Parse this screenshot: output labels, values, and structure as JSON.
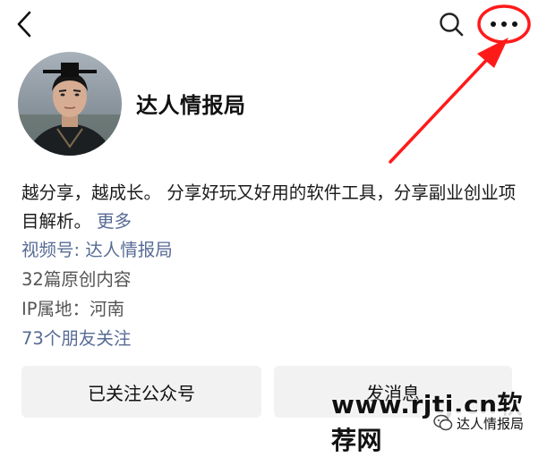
{
  "header": {
    "back_icon": "chevron-left-icon",
    "search_icon": "search-icon",
    "more_icon": "more-horizontal-icon"
  },
  "profile": {
    "name": "达人情报局"
  },
  "bio": {
    "text": "越分享，越成长。 分享好玩又好用的软件工具，分享副业创业项目解析。",
    "more_label": "更多"
  },
  "info": {
    "channels_label": "视频号: 达人情报局",
    "original_count": "32篇原创内容",
    "ip_location": "IP属地：河南",
    "friends_following": "73个朋友关注"
  },
  "actions": {
    "follow_label": "已关注公众号",
    "message_label": "发消息"
  },
  "watermark": {
    "site": "www.rjtj.cn软荐网",
    "account": "达人情报局"
  },
  "colors": {
    "link": "#576b95",
    "annotation": "#ff1a1a",
    "button_bg": "#f2f2f2"
  }
}
